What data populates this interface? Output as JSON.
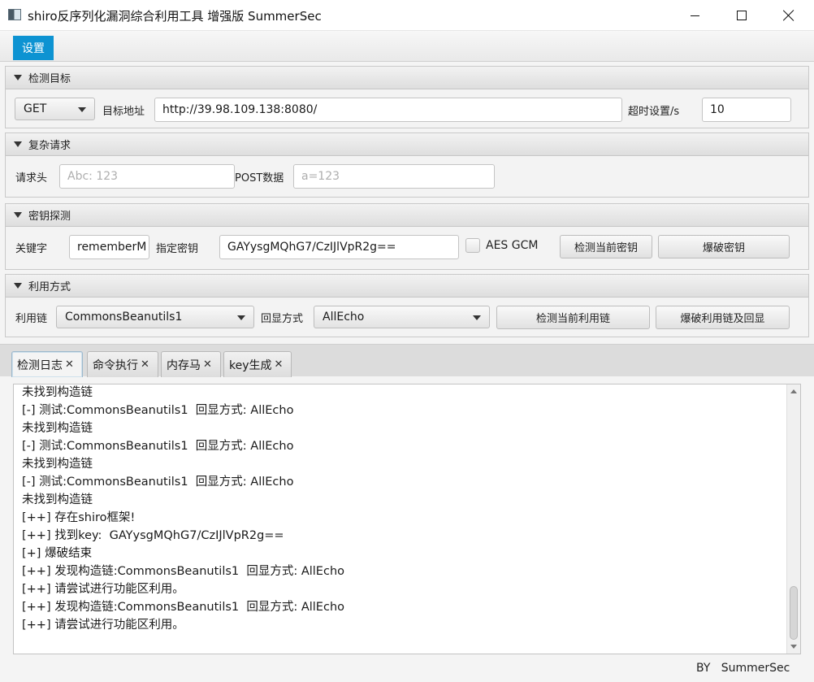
{
  "window": {
    "title": "shiro反序列化漏洞综合利用工具 增强版 SummerSec"
  },
  "menu": {
    "settings": "设置"
  },
  "target": {
    "header": "检测目标",
    "method": "GET",
    "url_label": "目标地址",
    "url_value": "http://39.98.109.138:8080/",
    "timeout_label": "超时设置/s",
    "timeout_value": "10"
  },
  "complex": {
    "header": "复杂请求",
    "headers_label": "请求头",
    "headers_placeholder": "Abc: 123",
    "post_label": "POST数据",
    "post_placeholder": "a=123"
  },
  "key_probe": {
    "header": "密钥探测",
    "keyword_label": "关键字",
    "keyword_value": "rememberM",
    "key_label": "指定密钥",
    "key_value": "GAYysgMQhG7/CzIJlVpR2g==",
    "aes_gcm_label": "AES GCM",
    "aes_gcm_checked": false,
    "check_key_button": "检测当前密钥",
    "brute_key_button": "爆破密钥"
  },
  "exploit": {
    "header": "利用方式",
    "chain_label": "利用链",
    "chain_value": "CommonsBeanutils1",
    "echo_label": "回显方式",
    "echo_value": "AllEcho",
    "check_chain_button": "检测当前利用链",
    "brute_chain_button": "爆破利用链及回显"
  },
  "tabs": [
    {
      "label": "检测日志",
      "active": true
    },
    {
      "label": "命令执行",
      "active": false
    },
    {
      "label": "内存马",
      "active": false
    },
    {
      "label": "key生成",
      "active": false
    }
  ],
  "log": [
    "未找到构造链",
    "[-] 测试:CommonsBeanutils1  回显方式: AllEcho",
    "未找到构造链",
    "[-] 测试:CommonsBeanutils1  回显方式: AllEcho",
    "未找到构造链",
    "[-] 测试:CommonsBeanutils1  回显方式: AllEcho",
    "未找到构造链",
    "[++] 存在shiro框架!",
    "[++] 找到key:  GAYysgMQhG7/CzIJlVpR2g==",
    "[+] 爆破结束",
    "[++] 发现构造链:CommonsBeanutils1  回显方式: AllEcho",
    "[++] 请尝试进行功能区利用。",
    "[++] 发现构造链:CommonsBeanutils1  回显方式: AllEcho",
    "[++] 请尝试进行功能区利用。"
  ],
  "footer": "BY   SummerSec"
}
